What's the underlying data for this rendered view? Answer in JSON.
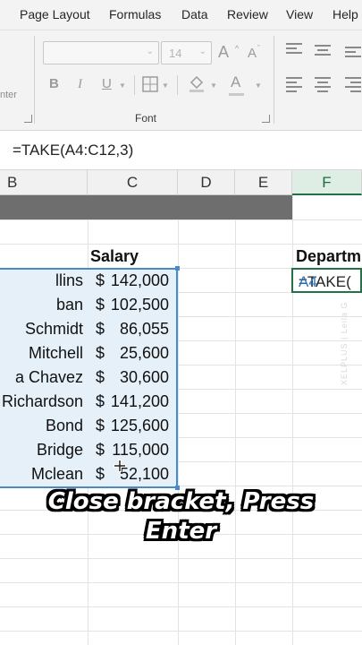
{
  "ribbon": {
    "tabs": [
      "Page Layout",
      "Formulas",
      "Data",
      "Review",
      "View",
      "Help"
    ],
    "font_size_placeholder": "14",
    "font_group_label": "Font",
    "partial_label": "nter",
    "buttons": {
      "grow": "A",
      "shrink": "A",
      "bold": "B",
      "italic": "I",
      "underline": "U",
      "font_color": "A"
    }
  },
  "formula_bar": {
    "formula": "=TAKE(A4:C12,3)"
  },
  "columns": [
    "B",
    "C",
    "D",
    "E",
    "F"
  ],
  "sheet": {
    "salary_header": "Salary",
    "department_header": "Departm",
    "rows": [
      {
        "name": "llins",
        "currency": "$",
        "salary": "142,000"
      },
      {
        "name": "ban",
        "currency": "$",
        "salary": "102,500"
      },
      {
        "name": "Schmidt",
        "currency": "$",
        "salary": "86,055"
      },
      {
        "name": "Mitchell",
        "currency": "$",
        "salary": "25,600"
      },
      {
        "name": "a Chavez",
        "currency": "$",
        "salary": "30,600"
      },
      {
        "name": "Richardson",
        "currency": "$",
        "salary": "141,200"
      },
      {
        "name": "Bond",
        "currency": "$",
        "salary": "125,600"
      },
      {
        "name": "Bridge",
        "currency": "$",
        "salary": "115,000"
      },
      {
        "name": "Mclean",
        "currency": "$",
        "salary": "52,100"
      }
    ],
    "active_cell_prefix": "=TAKE(",
    "active_cell_ref": "A4"
  },
  "watermark": "XELPLUS | Leila G",
  "caption": {
    "line1": "Close bracket, Press",
    "line2": "Enter"
  },
  "colors": {
    "accent": "#217346",
    "selection_border": "#4a8ac9",
    "selection_fill": "#e6f0f8",
    "banner": "#6e6e6e"
  }
}
